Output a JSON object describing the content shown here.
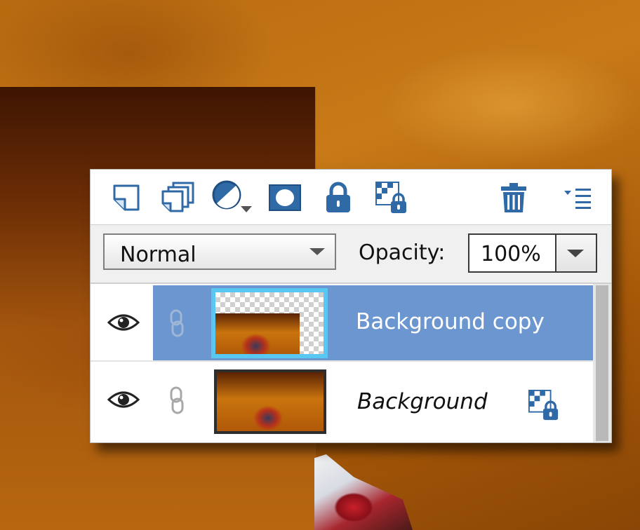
{
  "window": {
    "title": ""
  },
  "toolbar": {
    "buttons": [
      {
        "name": "new-layer-icon"
      },
      {
        "name": "duplicate-layer-icon"
      },
      {
        "name": "adjustment-layer-icon"
      },
      {
        "name": "layer-mask-icon"
      },
      {
        "name": "lock-all-icon"
      },
      {
        "name": "lock-transparency-icon"
      },
      {
        "name": "delete-layer-icon"
      },
      {
        "name": "panel-menu-icon"
      }
    ]
  },
  "blend": {
    "mode_value": "Normal",
    "opacity_label": "Opacity:",
    "opacity_value": "100%"
  },
  "layers": [
    {
      "name": "Background copy",
      "visible": true,
      "selected": true,
      "linked": true,
      "locked": false,
      "italic": false
    },
    {
      "name": "Background",
      "visible": true,
      "selected": false,
      "linked": true,
      "locked": true,
      "italic": true
    }
  ],
  "colors": {
    "selection": "#6b96cf",
    "thumb_highlight": "#58c8f2",
    "icon_blue": "#2f6aa6"
  }
}
